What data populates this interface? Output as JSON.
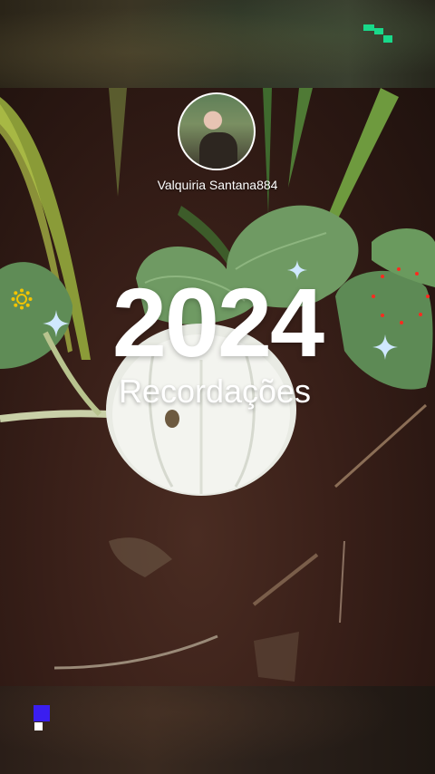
{
  "profile": {
    "username": "Valquiria Santana884"
  },
  "card": {
    "year": "2024",
    "subtitle": "Recordações"
  },
  "colors": {
    "logo_top": "#19d98a",
    "logo_bottom_blue": "#3a1ef0",
    "logo_bottom_white": "#ffffff",
    "sparkle": "#cfe8ff",
    "dots": "#ff2a1f",
    "sun": "#f2c400"
  },
  "icons": [
    "brand-logo-icon",
    "sparkle-icon",
    "sun-icon",
    "red-dots-decoration"
  ]
}
